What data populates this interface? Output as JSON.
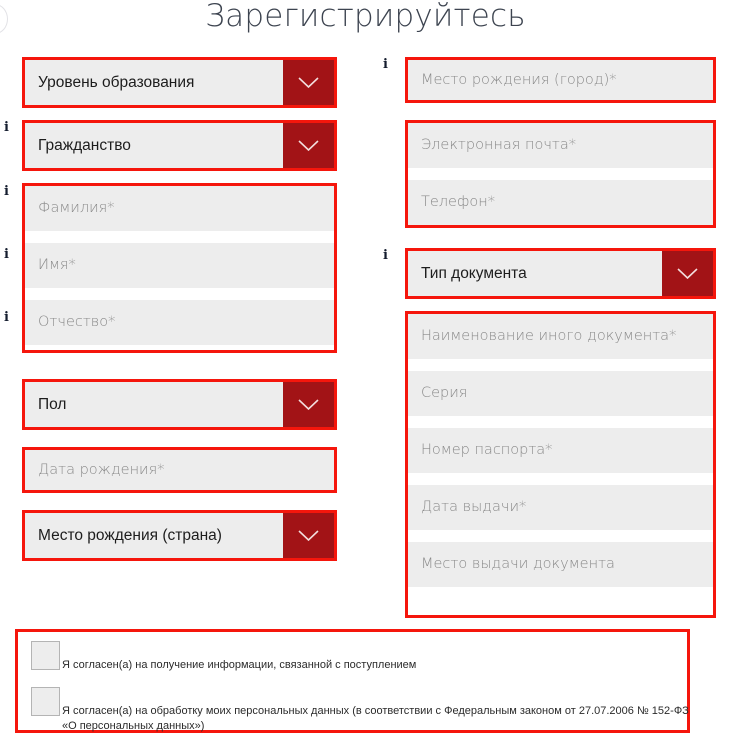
{
  "page": {
    "title": "Зарегистрируйтесь",
    "accent_color": "#f5160c",
    "dropdown_button_color": "#a21316",
    "field_background": "#ededed",
    "placeholder_color": "#8a8a8a",
    "info_marker": "i"
  },
  "left_column": {
    "education_level": {
      "label": "Уровень образования",
      "type": "select"
    },
    "citizenship": {
      "label": "Гражданство",
      "type": "select"
    },
    "name_group": [
      {
        "placeholder": "Фамилия*"
      },
      {
        "placeholder": "Имя*"
      },
      {
        "placeholder": "Отчество*"
      }
    ],
    "gender": {
      "label": "Пол",
      "type": "select"
    },
    "birth_date": {
      "placeholder": "Дата рождения*"
    },
    "birth_country": {
      "label": "Место рождения (страна)",
      "type": "select"
    }
  },
  "right_column": {
    "birth_city": {
      "placeholder": "Место рождения (город)*"
    },
    "contact_group": [
      {
        "placeholder": "Электронная почта*"
      },
      {
        "placeholder": "Телефон*"
      }
    ],
    "document_type": {
      "label": "Тип документа",
      "type": "select"
    },
    "document_group": [
      {
        "placeholder": "Наименование иного документа*"
      },
      {
        "placeholder": "Серия"
      },
      {
        "placeholder": "Номер паспорта*"
      },
      {
        "placeholder": "Дата выдачи*"
      },
      {
        "placeholder": "Место выдачи документа"
      }
    ]
  },
  "consents": [
    {
      "text": "Я согласен(а) на получение информации, связанной с поступлением",
      "checked": false
    },
    {
      "text": "Я согласен(а) на обработку моих персональных данных (в соответствии с Федеральным законом от 27.07.2006 № 152-ФЗ «О персональных данных»)",
      "checked": false
    }
  ]
}
